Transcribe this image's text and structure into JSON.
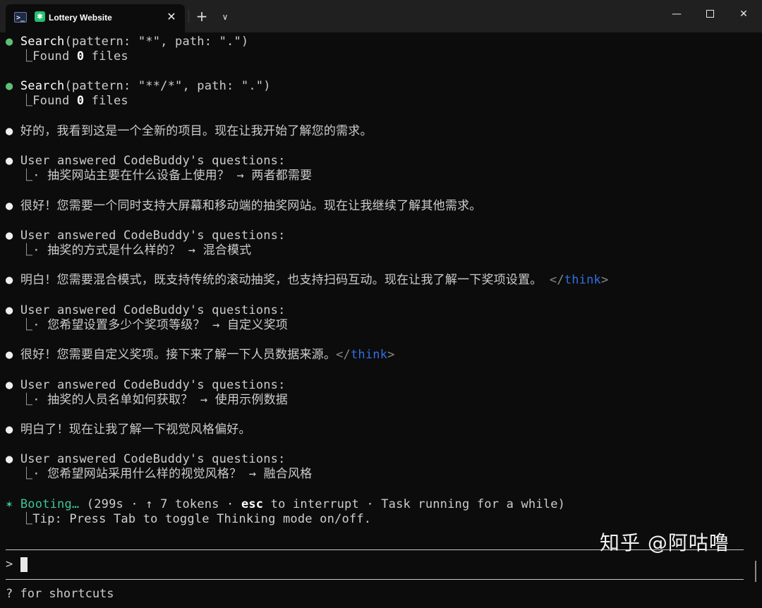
{
  "window": {
    "tab_title": "Lottery Website",
    "ps_icon_glyph": ">_",
    "app_icon_glyph": "✱",
    "close_glyph": "✕",
    "newtab_glyph": "+",
    "dropdown_glyph": "∨",
    "minimize_glyph": "—",
    "close_window_glyph": "✕"
  },
  "terminal": {
    "bullet": "●",
    "tree": "⎿",
    "search1": {
      "fn": "Search",
      "args": "(pattern: \"*\", path: \".\")",
      "result_prefix": "Found ",
      "result_count": "0",
      "result_suffix": " files"
    },
    "search2": {
      "fn": "Search",
      "args": "(pattern: \"**/*\", path: \".\")",
      "result_prefix": "Found ",
      "result_count": "0",
      "result_suffix": " files"
    },
    "msg1": "好的，我看到这是一个全新的项目。现在让我开始了解您的需求。",
    "qa_header": "User answered CodeBuddy's questions:",
    "qa1": "· 抽奖网站主要在什么设备上使用？ → 两者都需要",
    "msg2": "很好！您需要一个同时支持大屏幕和移动端的抽奖网站。现在让我继续了解其他需求。",
    "qa2": "· 抽奖的方式是什么样的？ → 混合模式",
    "msg3": "明白！您需要混合模式，既支持传统的滚动抽奖，也支持扫码互动。现在让我了解一下奖项设置。",
    "think_open": "</",
    "think_word": "think",
    "think_close": ">",
    "qa3": "· 您希望设置多少个奖项等级？ → 自定义奖项",
    "msg4": "很好！您需要自定义奖项。接下来了解一下人员数据来源。",
    "qa4": "· 抽奖的人员名单如何获取？ → 使用示例数据",
    "msg5": "明白了！现在让我了解一下视觉风格偏好。",
    "qa5": "· 您希望网站采用什么样的视觉风格？ → 融合风格",
    "status": {
      "star": "✶",
      "label": "Booting…",
      "detail_before": " (299s · ↑ 7 tokens · ",
      "key": "esc",
      "detail_after": " to interrupt · Task running for a while)",
      "tip": "Tip: Press Tab to toggle Thinking mode on/off."
    },
    "prompt": ">",
    "footer": "? for shortcuts",
    "watermark": "知乎 @阿咕噜"
  }
}
